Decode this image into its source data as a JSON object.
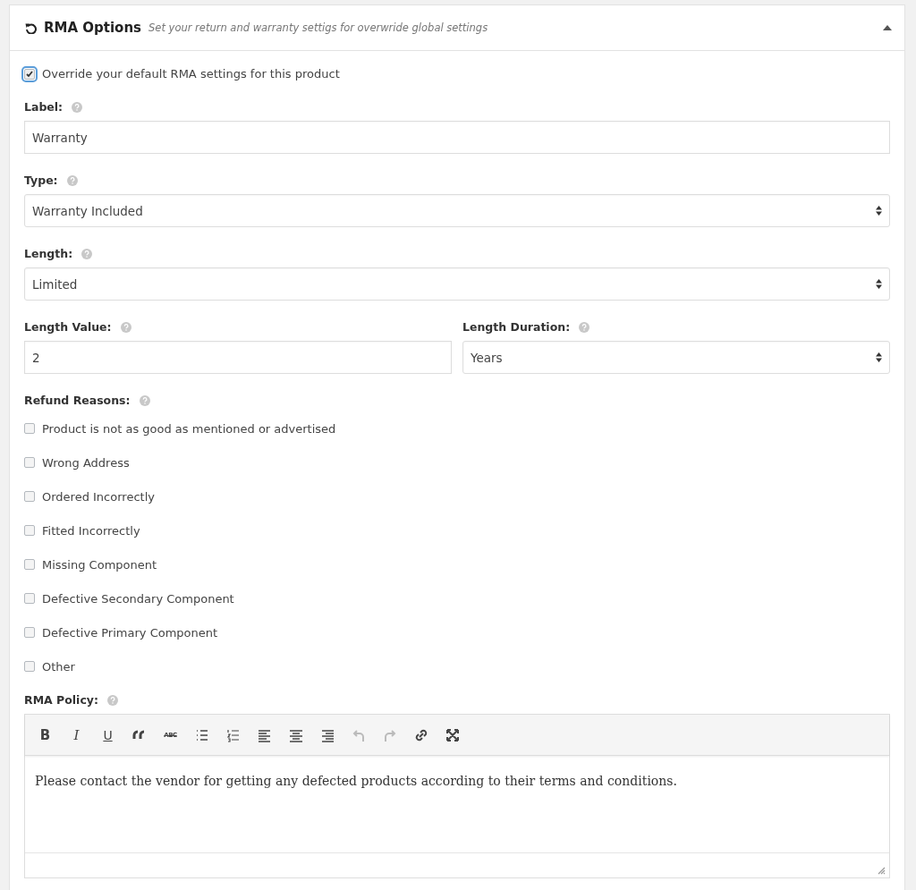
{
  "panel": {
    "title": "RMA Options",
    "subtitle": "Set your return and warranty settigs for overwride global settings",
    "expanded": true
  },
  "override": {
    "label": "Override your default RMA settings for this product",
    "checked": true
  },
  "fields": [
    {
      "kind": "text",
      "label": "Label:",
      "value": "Warranty"
    },
    {
      "kind": "select",
      "label": "Type:",
      "value": "Warranty Included"
    },
    {
      "kind": "select",
      "label": "Length:",
      "value": "Limited"
    }
  ],
  "pair": [
    {
      "kind": "text",
      "label": "Length Value:",
      "value": "2"
    },
    {
      "kind": "select",
      "label": "Length Duration:",
      "value": "Years"
    }
  ],
  "refund_reasons": {
    "label": "Refund Reasons:",
    "items": [
      {
        "label": "Product is not as good as mentioned or advertised",
        "checked": false
      },
      {
        "label": "Wrong Address",
        "checked": false
      },
      {
        "label": "Ordered Incorrectly",
        "checked": false
      },
      {
        "label": "Fitted Incorrectly",
        "checked": false
      },
      {
        "label": "Missing Component",
        "checked": false
      },
      {
        "label": "Defective Secondary Component",
        "checked": false
      },
      {
        "label": "Defective Primary Component",
        "checked": false
      },
      {
        "label": "Other",
        "checked": false
      }
    ]
  },
  "policy": {
    "label": "RMA Policy:",
    "toolbar": [
      {
        "kind": "bold",
        "glyph": "B",
        "disabled": false
      },
      {
        "kind": "italic",
        "glyph": "I",
        "disabled": false
      },
      {
        "kind": "underline",
        "glyph": "U",
        "disabled": false
      },
      {
        "kind": "quote",
        "disabled": false
      },
      {
        "kind": "strike",
        "glyph": "ABC",
        "disabled": false
      },
      {
        "kind": "bullets",
        "disabled": false
      },
      {
        "kind": "numbers",
        "disabled": false
      },
      {
        "kind": "align-left",
        "disabled": false
      },
      {
        "kind": "align-center",
        "disabled": false
      },
      {
        "kind": "align-right",
        "disabled": false
      },
      {
        "kind": "undo",
        "disabled": true
      },
      {
        "kind": "redo",
        "disabled": true
      },
      {
        "kind": "link",
        "disabled": false
      },
      {
        "kind": "fullscreen",
        "disabled": false
      }
    ],
    "text": "Please contact the vendor for getting any defected products according to their terms and conditions."
  }
}
